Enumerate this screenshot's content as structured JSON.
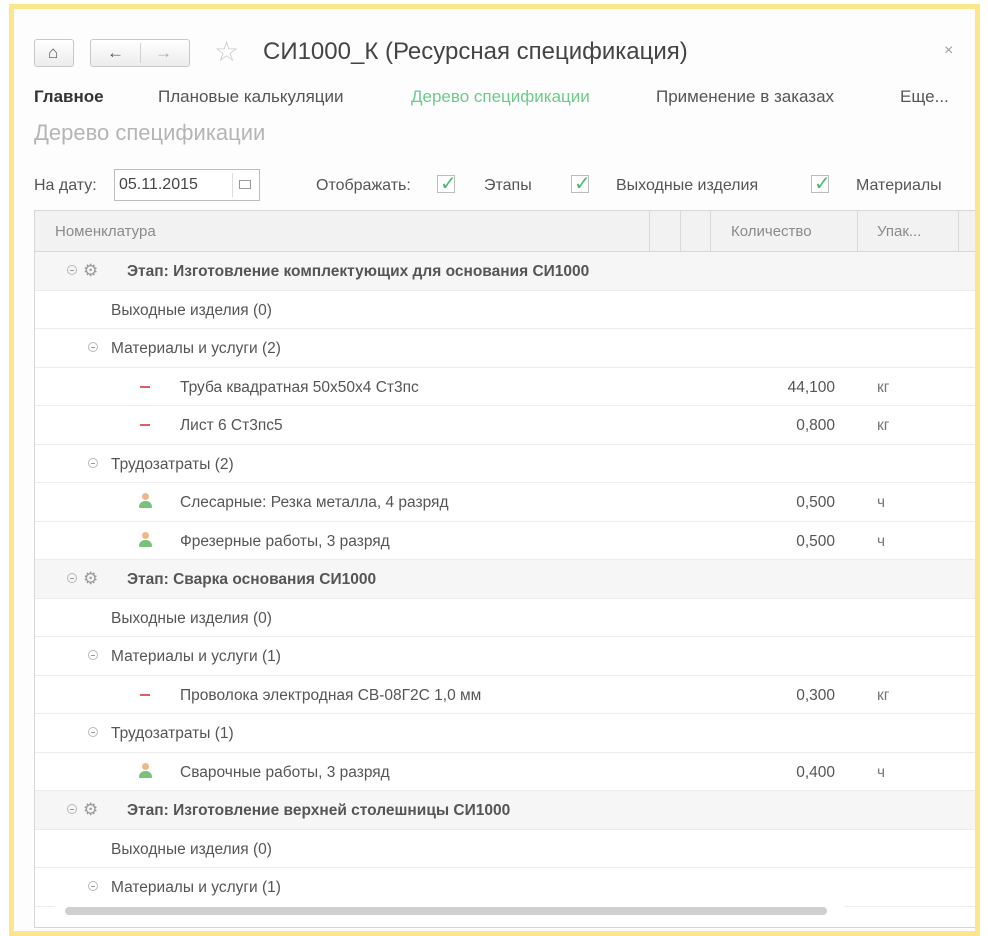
{
  "window": {
    "title": "СИ1000_К (Ресурсная спецификация)",
    "close_glyph": "×",
    "home_icon": "home-icon",
    "back_icon": "arrow-left-icon",
    "forward_icon": "arrow-right-icon",
    "favorite_icon": "star-icon"
  },
  "tabs": [
    {
      "label": "Главное"
    },
    {
      "label": "Плановые калькуляции"
    },
    {
      "label": "Дерево спецификации"
    },
    {
      "label": "Применение в заказах"
    },
    {
      "label": "Еще..."
    }
  ],
  "section_title": "Дерево спецификации",
  "filters": {
    "date_label": "На дату:",
    "date_value": "05.11.2015",
    "show_label": "Отображать:",
    "checkboxes": [
      {
        "label": "Этапы",
        "checked": true
      },
      {
        "label": "Выходные изделия",
        "checked": true
      },
      {
        "label": "Материалы",
        "checked": true
      }
    ]
  },
  "grid": {
    "columns": [
      "Номенклатура",
      "Количество",
      "Упак..."
    ],
    "rows": [
      {
        "type": "stage",
        "name": "Этап: Изготовление комплектующих для основания СИ1000",
        "qty": "",
        "unit": ""
      },
      {
        "type": "group-leaf",
        "name": "Выходные изделия (0)",
        "qty": "",
        "unit": ""
      },
      {
        "type": "group",
        "name": "Материалы и услуги (2)",
        "qty": "",
        "unit": ""
      },
      {
        "type": "material",
        "name": "Труба квадратная 50х50х4 Ст3пс",
        "qty": "44,100",
        "unit": "кг"
      },
      {
        "type": "material",
        "name": "Лист 6 Ст3пс5",
        "qty": "0,800",
        "unit": "кг"
      },
      {
        "type": "group",
        "name": "Трудозатраты (2)",
        "qty": "",
        "unit": ""
      },
      {
        "type": "labor",
        "name": "Слесарные: Резка металла, 4 разряд",
        "qty": "0,500",
        "unit": "ч"
      },
      {
        "type": "labor",
        "name": "Фрезерные работы, 3 разряд",
        "qty": "0,500",
        "unit": "ч"
      },
      {
        "type": "stage",
        "name": "Этап: Сварка основания СИ1000",
        "qty": "",
        "unit": ""
      },
      {
        "type": "group-leaf",
        "name": "Выходные изделия (0)",
        "qty": "",
        "unit": ""
      },
      {
        "type": "group",
        "name": "Материалы и услуги (1)",
        "qty": "",
        "unit": ""
      },
      {
        "type": "material",
        "name": "Проволока электродная СВ-08Г2С 1,0 мм",
        "qty": "0,300",
        "unit": "кг"
      },
      {
        "type": "group",
        "name": "Трудозатраты (1)",
        "qty": "",
        "unit": ""
      },
      {
        "type": "labor",
        "name": "Сварочные работы, 3 разряд",
        "qty": "0,400",
        "unit": "ч"
      },
      {
        "type": "stage",
        "name": "Этап: Изготовление верхней столешницы СИ1000",
        "qty": "",
        "unit": ""
      },
      {
        "type": "group-leaf",
        "name": "Выходные изделия (0)",
        "qty": "",
        "unit": ""
      },
      {
        "type": "group",
        "name": "Материалы и услуги (1)",
        "qty": "",
        "unit": ""
      }
    ]
  }
}
